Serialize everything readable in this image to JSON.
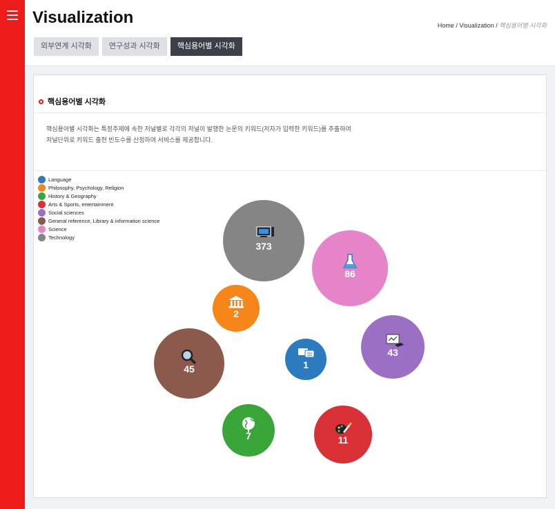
{
  "header": {
    "title": "Visualization",
    "breadcrumb": {
      "home": "Home",
      "sep1": " / ",
      "mid": "Visualization",
      "sep2": " / ",
      "current": "핵심용어별 시각화"
    },
    "tabs": [
      {
        "label": "외부연계 시각화"
      },
      {
        "label": "연구성과 시각화"
      },
      {
        "label": "핵심용어별 시각화"
      }
    ]
  },
  "section": {
    "title": "핵심용어별 시각화",
    "desc_line1": "핵심용어별 시각화는 특정주제에 속한 저널별로 각각의 저널이 발행한 논문의 키워드(저자가 입력한 키워드)를 추출하여",
    "desc_line2": "저널단위로 키워드 출현 빈도수를 산정하여 서비스를 제공합니다."
  },
  "chart_data": {
    "type": "bubble",
    "legend_position": "top-left",
    "series": [
      {
        "name": "Language",
        "value": 1,
        "color": "#2c7bbf",
        "icon": "speech-bubbles-icon"
      },
      {
        "name": "Philosophy, Psychology, Religion",
        "value": 2,
        "color": "#f7861a",
        "icon": "temple-icon"
      },
      {
        "name": "History & Geography",
        "value": 7,
        "color": "#3aa63a",
        "icon": "globe-icon"
      },
      {
        "name": "Arts & Sports, entertainment",
        "value": 11,
        "color": "#d93035",
        "icon": "palette-brush-icon"
      },
      {
        "name": "Social sciences",
        "value": 43,
        "color": "#9b6fc4",
        "icon": "presentation-icon"
      },
      {
        "name": "General reference, Library & information science",
        "value": 45,
        "color": "#8c5a4d",
        "icon": "magnifier-icon"
      },
      {
        "name": "Science",
        "value": 86,
        "color": "#e584c8",
        "icon": "flask-icon"
      },
      {
        "name": "Technology",
        "value": 373,
        "color": "#858585",
        "icon": "computer-icon"
      }
    ]
  }
}
